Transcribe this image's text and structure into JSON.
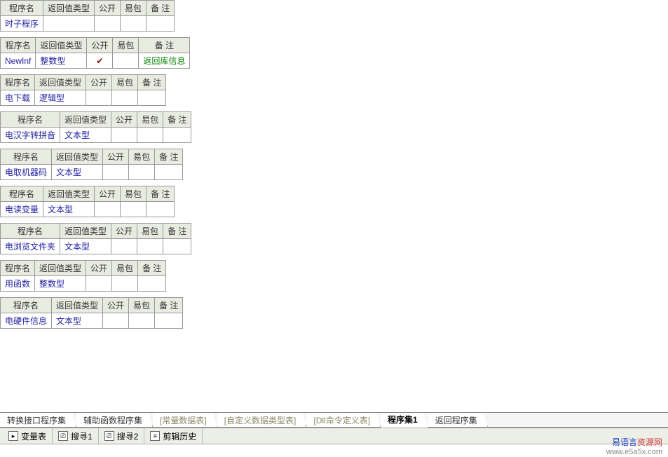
{
  "headers": {
    "name": "程序名",
    "ret": "返回值类型",
    "pub": "公开",
    "pkg": "易包",
    "note": "备 注"
  },
  "tables": [
    {
      "name": "时子程序",
      "ret": "",
      "note": ""
    },
    {
      "name": "NewInf",
      "ret": "整数型",
      "checked": true,
      "note": "返回库信息",
      "noteClass": "green-text"
    },
    {
      "name": "电下载",
      "ret": "逻辑型",
      "note": ""
    },
    {
      "name": "电汉字转拼音",
      "ret": "文本型",
      "note": ""
    },
    {
      "name": "电取机器码",
      "ret": "文本型",
      "note": ""
    },
    {
      "name": "电读变量",
      "ret": "文本型",
      "note": ""
    },
    {
      "name": "电浏览文件夹",
      "ret": "文本型",
      "note": ""
    },
    {
      "name": "用函数",
      "ret": "整数型",
      "note": ""
    },
    {
      "name": "电硬件信息",
      "ret": "文本型",
      "note": ""
    }
  ],
  "tabs": [
    {
      "label": "转换接口程序集",
      "cls": "normal"
    },
    {
      "label": "辅助函数程序集",
      "cls": "normal"
    },
    {
      "label": "[常量数据表]",
      "cls": "bracket"
    },
    {
      "label": "[自定义数据类型表]",
      "cls": "bracket"
    },
    {
      "label": "[Dll命令定义表]",
      "cls": "bracket"
    },
    {
      "label": "程序集1",
      "cls": "active"
    },
    {
      "label": "返回程序集",
      "cls": "normal"
    }
  ],
  "status": [
    {
      "label": "变量表",
      "icon": "▸"
    },
    {
      "label": "搜寻1",
      "icon": "⎚"
    },
    {
      "label": "搜寻2",
      "icon": "⎚"
    },
    {
      "label": "剪辑历史",
      "icon": "≡"
    }
  ],
  "footer": {
    "main_a": "易语言",
    "main_b": "资源网",
    "sub": "www.e5a5x.com"
  }
}
